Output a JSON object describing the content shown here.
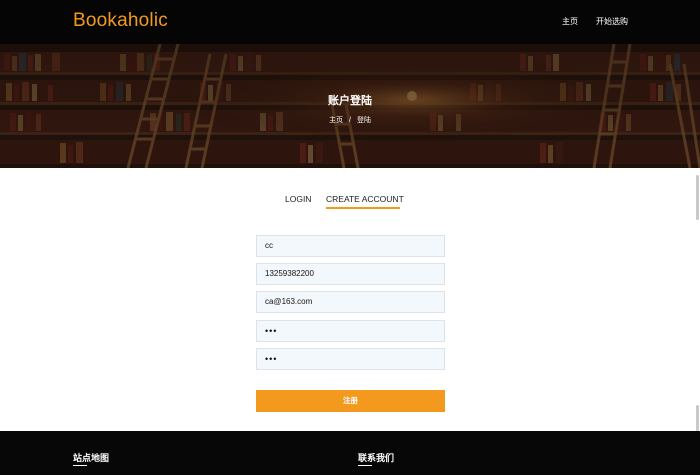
{
  "header": {
    "brand": "Bookaholic",
    "nav": [
      "主页",
      "开始选购"
    ]
  },
  "hero": {
    "title": "账户登陆",
    "breadcrumb": [
      "主页",
      "/",
      "登陆"
    ]
  },
  "tabs": {
    "login": "LOGIN",
    "create": "CREATE ACCOUNT",
    "active": "CREATE ACCOUNT"
  },
  "form": {
    "username": "cc",
    "phone": "13259382200",
    "email": "ca@163.com",
    "password": "•••",
    "confirm_password": "•••",
    "submit": "注册"
  },
  "footer": {
    "sitemap": "站点地图",
    "contact": "联系我们"
  },
  "colors": {
    "accent": "#f39a1e",
    "header_bg": "#050505",
    "field_bg": "#f3f8fd"
  }
}
